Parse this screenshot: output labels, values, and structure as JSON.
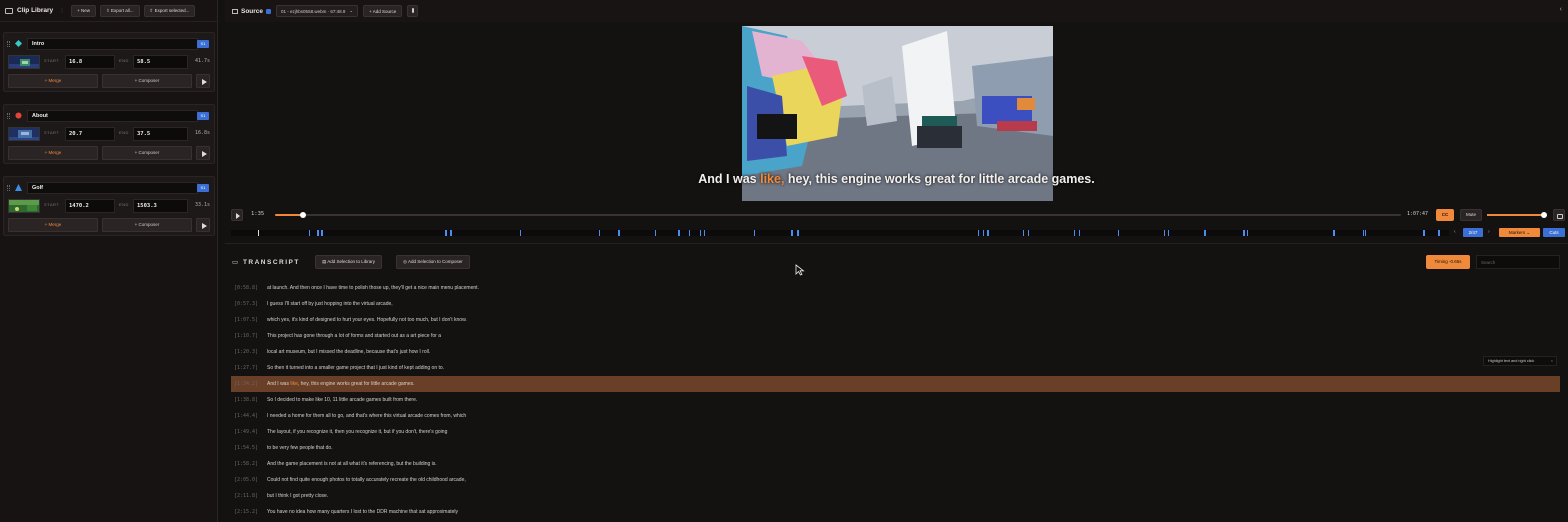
{
  "sidebar": {
    "title": "Clip Library",
    "new_label": "+ New",
    "export_all_label": "⇧ Export all...",
    "export_selected_label": "⇧ Export selected...",
    "clips": [
      {
        "name": "Intro",
        "badge": "S1",
        "start_label": "START",
        "start": "16.8",
        "end_label": "END",
        "end": "58.5",
        "duration": "41.7s",
        "merge_label": "+ Merge",
        "composer_label": "+ Composer",
        "icon_color": "#37c8c8"
      },
      {
        "name": "About",
        "badge": "S1",
        "start_label": "START",
        "start": "20.7",
        "end_label": "END",
        "end": "37.5",
        "duration": "16.8s",
        "merge_label": "+ Merge",
        "composer_label": "+ Composer",
        "icon_color": "#e0453a"
      },
      {
        "name": "Golf",
        "badge": "S1",
        "start_label": "START",
        "start": "1470.2",
        "end_label": "END",
        "end": "1503.3",
        "duration": "33.1s",
        "merge_label": "+ Merge",
        "composer_label": "+ Composer",
        "icon_color": "#3b8ee8"
      }
    ]
  },
  "source": {
    "title": "Source",
    "file": "01 - ezjhbs0558.webm · 67:48.9",
    "add_label": "+ Add Source"
  },
  "player": {
    "caption_before": "And I was ",
    "caption_highlight": "like,",
    "caption_after": " hey, this engine works great for little arcade games.",
    "current_time": "1:35",
    "total_time": "1:07:47",
    "progress": 0.025,
    "cc_label": "CC",
    "mute_label": "Mute",
    "volume": 0.98
  },
  "markers": {
    "count_label": "2/47",
    "markers_label": "Markers ⌄",
    "cuts_label": "Cuts",
    "positions": [
      0.022,
      0.064,
      0.071,
      0.074,
      0.176,
      0.18,
      0.237,
      0.302,
      0.318,
      0.348,
      0.367,
      0.376,
      0.385,
      0.388,
      0.429,
      0.46,
      0.465,
      0.613,
      0.617,
      0.621,
      0.65,
      0.654,
      0.692,
      0.696,
      0.728,
      0.766,
      0.769,
      0.799,
      0.831,
      0.834,
      0.905,
      0.929,
      0.931,
      0.979,
      0.991
    ],
    "current_position": 0.022
  },
  "transcript": {
    "title": "TRANSCRIPT",
    "add_library_label": "Add Selection to Library",
    "add_composer_label": "Add Selection to Composer",
    "timing_label": "Timing -0.65s",
    "search_placeholder": "Search",
    "tooltip": "Highlight text and right click",
    "lines": [
      {
        "ts": "[0:58.8]",
        "text": "at launch. And then once I have time to polish those up, they'll get a nice main menu placement."
      },
      {
        "ts": "[0:57.3]",
        "text": "I guess I'll start off by just hopping into the virtual arcade,"
      },
      {
        "ts": "[1:07.5]",
        "text": "which yes, it's kind of designed to hurt your eyes. Hopefully not too much, but I don't know."
      },
      {
        "ts": "[1:10.7]",
        "text": "This project has gone through a lot of forms and started out as a art piece for a"
      },
      {
        "ts": "[1:20.3]",
        "text": "local art museum, but I missed the deadline, because that's just how I roll."
      },
      {
        "ts": "[1:27.7]",
        "text": "So then it turned into a smaller game project that I just kind of kept adding on to."
      },
      {
        "ts": "[1:34.2]",
        "text_before": "And I was ",
        "text_highlight": "like",
        "text_after": ", hey, this engine works great for little arcade games.",
        "active": true
      },
      {
        "ts": "[1:38.8]",
        "text": "So I decided to make like 10, 11 little arcade games built from there."
      },
      {
        "ts": "[1:44.4]",
        "text": "I needed a home for them all to go, and that's where this virtual arcade comes from, which"
      },
      {
        "ts": "[1:49.4]",
        "text": "The layout, if you recognize it, then you recognize it, but if you don't, there's going"
      },
      {
        "ts": "[1:54.5]",
        "text": "to be very few people that do."
      },
      {
        "ts": "[1:58.2]",
        "text": "And the game placement is not at all what it's referencing, but the building is."
      },
      {
        "ts": "[2:05.0]",
        "text": "Could not find quite enough photos to totally accurately recreate the old childhood arcade,"
      },
      {
        "ts": "[2:11.8]",
        "text": "but I think I got pretty close."
      },
      {
        "ts": "[2:15.2]",
        "text": "You have no idea how many quarters I lost to the DDR machine that sat approximately"
      }
    ]
  }
}
